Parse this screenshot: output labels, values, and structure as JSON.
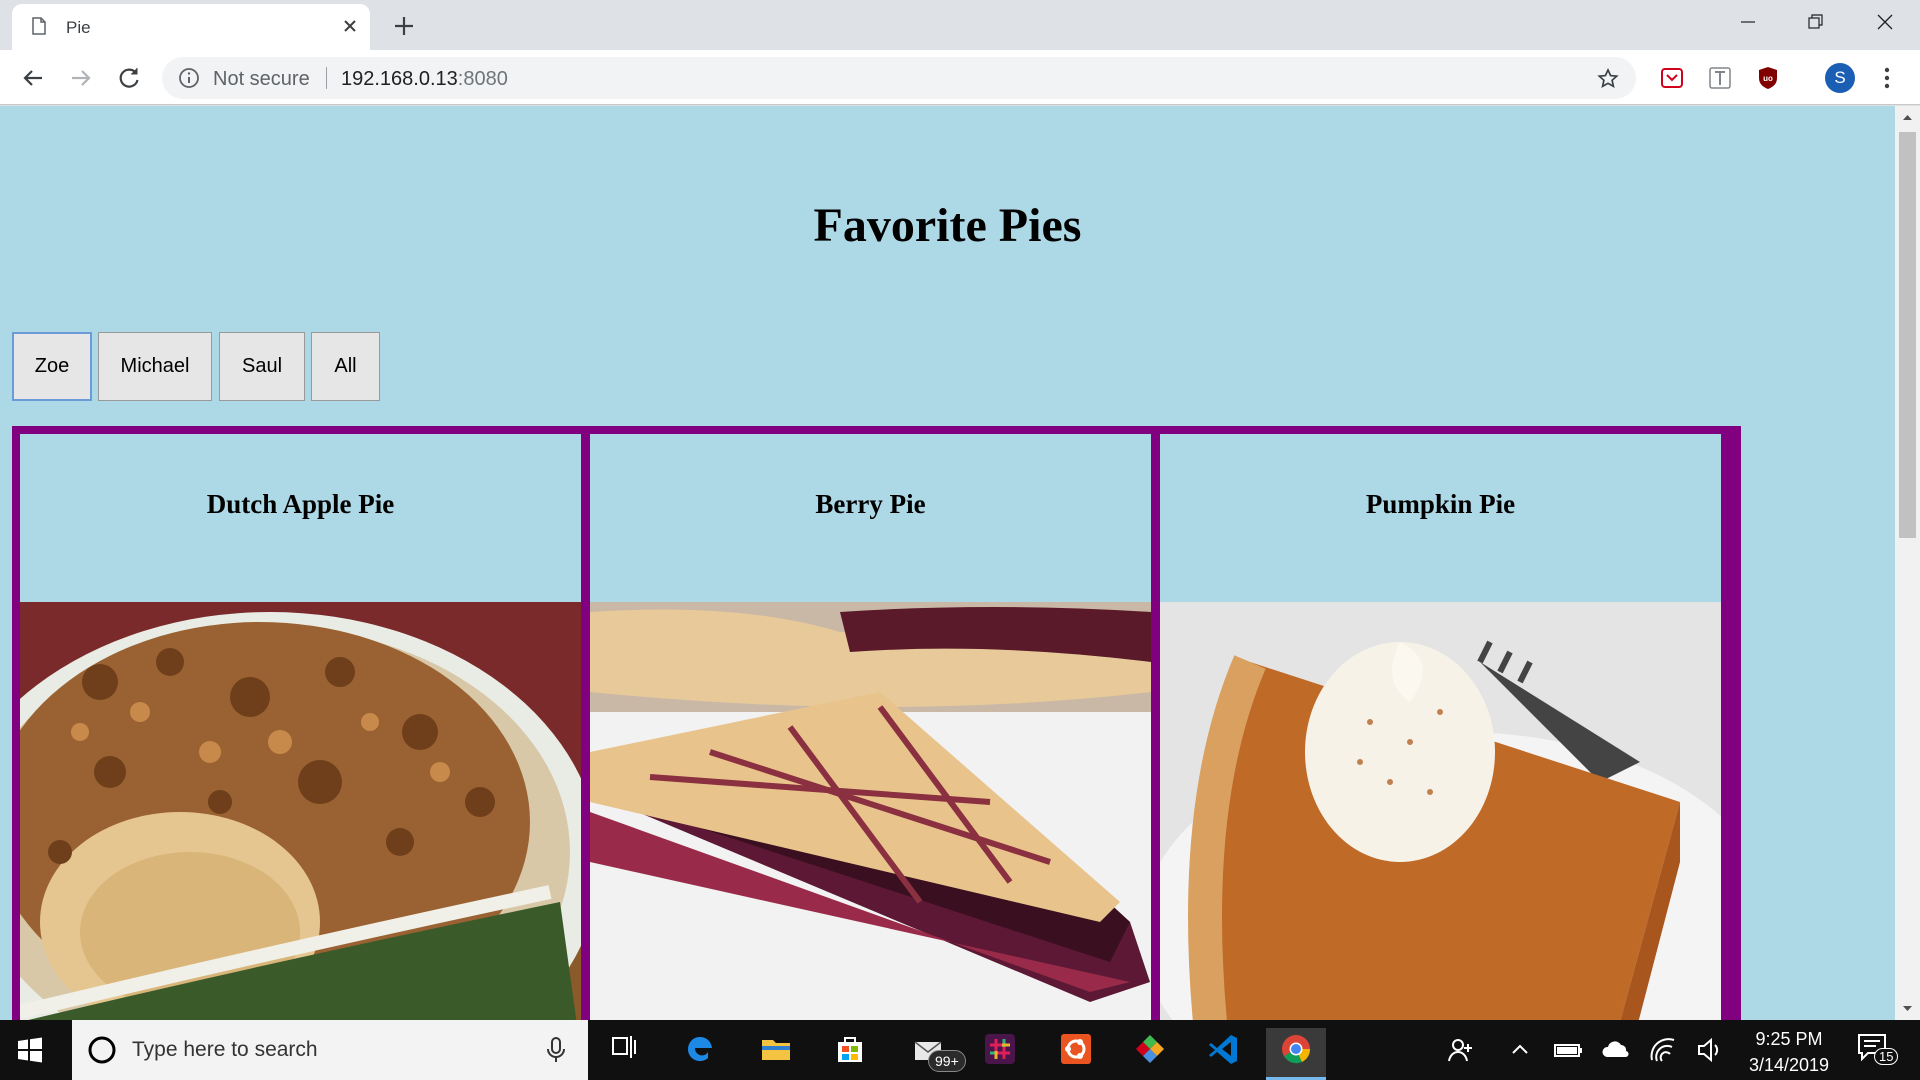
{
  "browser": {
    "tab_title": "Pie",
    "address": {
      "security_label": "Not secure",
      "host": "192.168.0.13",
      "port": ":8080"
    },
    "profile_initial": "S"
  },
  "page": {
    "heading": "Favorite Pies",
    "filters": [
      {
        "label": "Zoe",
        "selected": true
      },
      {
        "label": "Michael",
        "selected": false
      },
      {
        "label": "Saul",
        "selected": false
      },
      {
        "label": "All",
        "selected": false
      }
    ],
    "pies": [
      {
        "name": "Dutch Apple Pie",
        "image": "dutch-apple-pie-photo"
      },
      {
        "name": "Berry Pie",
        "image": "berry-pie-photo"
      },
      {
        "name": "Pumpkin Pie",
        "image": "pumpkin-pie-photo"
      }
    ],
    "colors": {
      "background": "#add8e6",
      "card_border": "#800080"
    }
  },
  "taskbar": {
    "search_placeholder": "Type here to search",
    "mail_badge": "99+",
    "time": "9:25 PM",
    "date": "3/14/2019",
    "notification_count": "15"
  }
}
